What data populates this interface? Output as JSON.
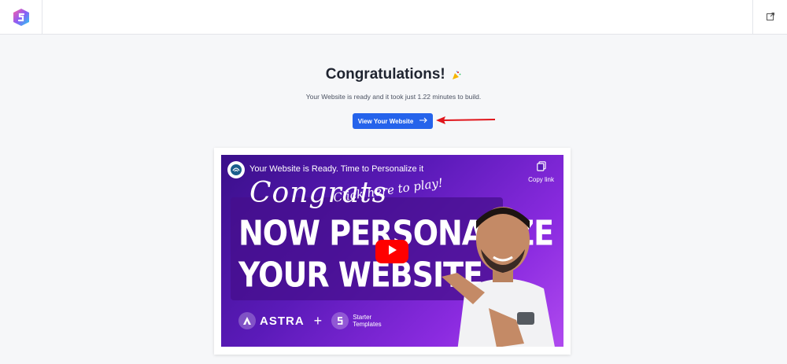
{
  "header": {
    "logo": "starter-templates-logo",
    "external_link_icon": "external-link-icon"
  },
  "main": {
    "title": "Congratulations!",
    "title_icon": "party-popper-icon",
    "subtitle": "Your Website is ready and it took just 1.22 minutes to build.",
    "view_button_label": "View Your Website",
    "view_button_icon": "arrow-right-icon"
  },
  "video": {
    "title": "Your Website is Ready. Time to Personalize it",
    "copy_link_label": "Copy link",
    "thumbnail": {
      "script_text": "Congrats",
      "click_text": "Click here to play!",
      "headline_line1": "NOW PERSONALIZE",
      "headline_line2": "YOUR WEBSITE",
      "brand1": "ASTRA",
      "plus": "+",
      "brand2_line1": "Starter",
      "brand2_line2": "Templates"
    }
  },
  "colors": {
    "accent": "#2563eb",
    "annotation_arrow": "#e0151b",
    "youtube_red": "#ff0000"
  }
}
